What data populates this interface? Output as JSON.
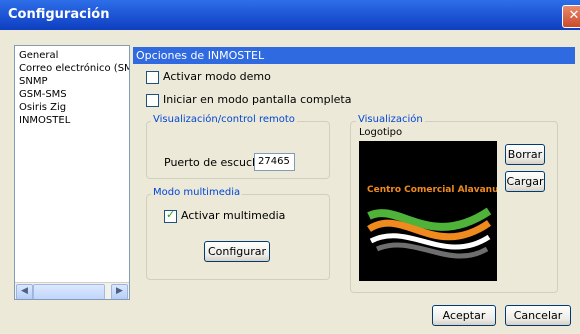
{
  "window": {
    "title": "Configuración",
    "close_glyph": "✕"
  },
  "sidebar": {
    "items": [
      {
        "label": "General"
      },
      {
        "label": "Correo electrónico (SMT"
      },
      {
        "label": "SNMP"
      },
      {
        "label": "GSM-SMS"
      },
      {
        "label": "Osiris Zig"
      },
      {
        "label": "INMOSTEL"
      }
    ],
    "selected": "INMOSTEL",
    "scroll_left_glyph": "◀",
    "scroll_right_glyph": "▶"
  },
  "section": {
    "title": "Opciones de INMOSTEL"
  },
  "options": {
    "demo_label": "Activar modo demo",
    "demo_checked": false,
    "fullscreen_label": "Iniciar en modo pantalla completa",
    "fullscreen_checked": false
  },
  "remote": {
    "group_title": "Visualización/control remoto",
    "port_label": "Puerto de escucha",
    "port_value": "27465"
  },
  "multimedia": {
    "group_title": "Modo multimedia",
    "activate_label": "Activar multimedia",
    "activate_checked": true,
    "configure_button": "Configurar"
  },
  "display": {
    "group_title": "Visualización",
    "logo_label": "Logotipo",
    "logo_text": "Centro Comercial Alavanus",
    "delete_button": "Borrar",
    "load_button": "Cargar"
  },
  "footer": {
    "accept_button": "Aceptar",
    "cancel_button": "Cancelar"
  },
  "colors": {
    "title_bar": "#1F58D8",
    "section_header": "#2F6AE0",
    "group_title": "#0046D5",
    "logo_orange": "#F08A1E",
    "logo_green": "#4FB33A"
  }
}
